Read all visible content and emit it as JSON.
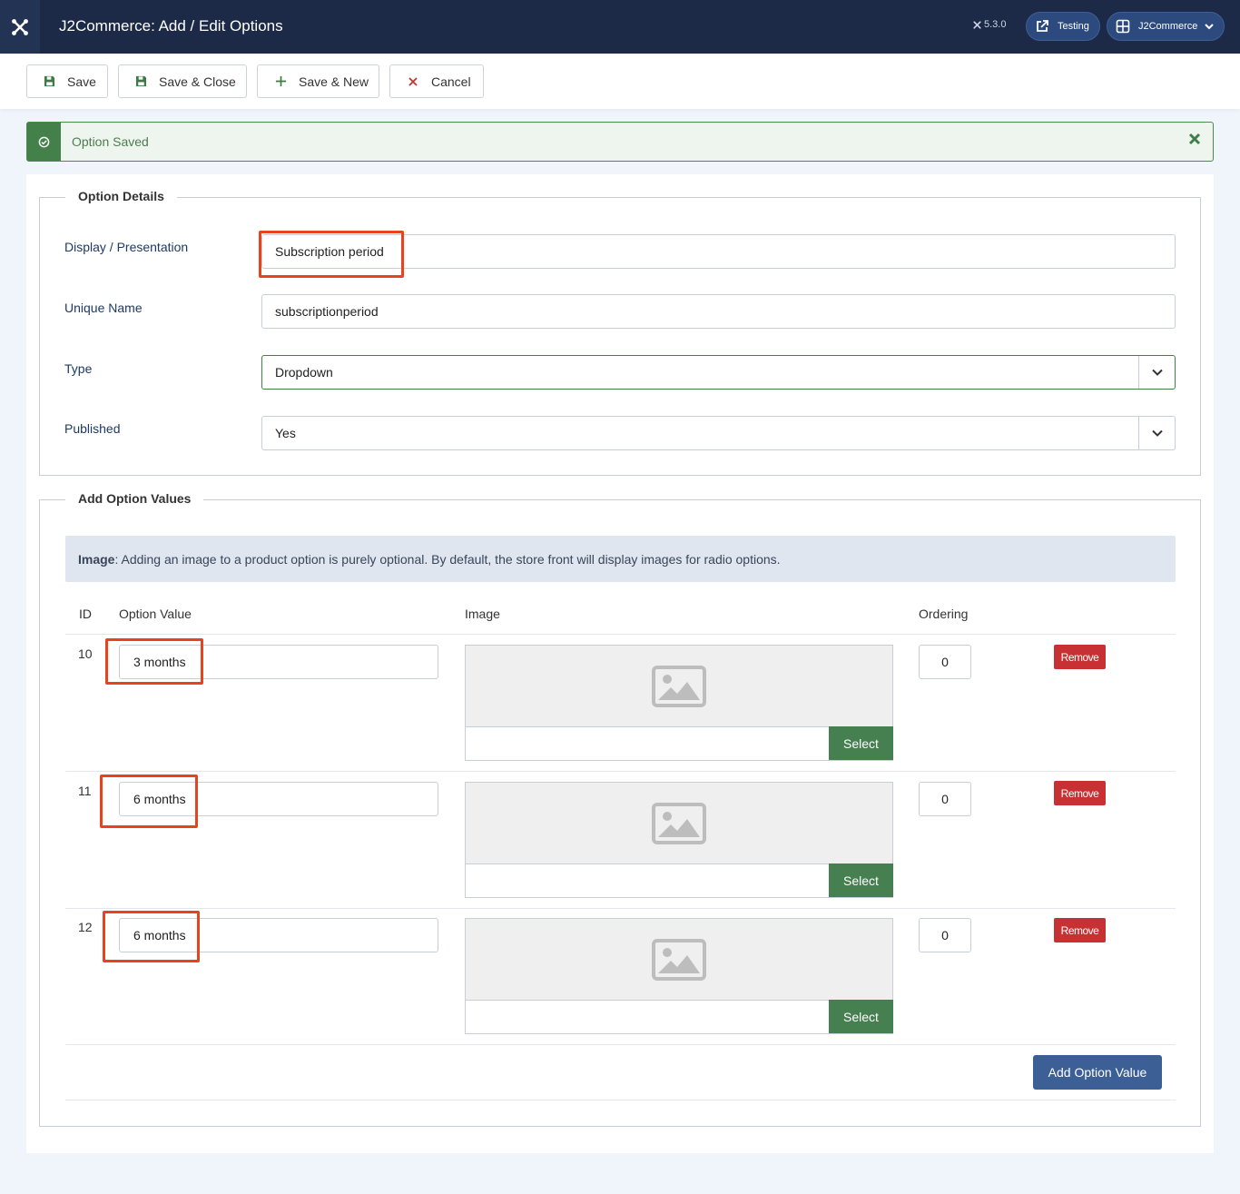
{
  "header": {
    "title": "J2Commerce: Add / Edit Options",
    "version": "5.3.0",
    "site_link_label": "Testing",
    "account_label": "J2Commerce"
  },
  "toolbar": {
    "save_label": "Save",
    "save_close_label": "Save & Close",
    "save_new_label": "Save & New",
    "cancel_label": "Cancel"
  },
  "alert": {
    "message": "Option Saved"
  },
  "option_details": {
    "legend": "Option Details",
    "display_label": "Display / Presentation",
    "display_value": "Subscription period",
    "unique_name_label": "Unique Name",
    "unique_name_value": "subscriptionperiod",
    "type_label": "Type",
    "type_value": "Dropdown",
    "published_label": "Published",
    "published_value": "Yes"
  },
  "option_values": {
    "legend": "Add Option Values",
    "info_bold": "Image",
    "info_text": ": Adding an image to a product option is purely optional. By default, the store front will display images for radio options.",
    "columns": {
      "id": "ID",
      "value": "Option Value",
      "image": "Image",
      "ordering": "Ordering"
    },
    "rows": [
      {
        "id": "10",
        "value": "3 months",
        "ordering": "0",
        "select_label": "Select",
        "remove_label": "Remove"
      },
      {
        "id": "11",
        "value": "6 months",
        "ordering": "0",
        "select_label": "Select",
        "remove_label": "Remove"
      },
      {
        "id": "12",
        "value": "6 months",
        "ordering": "0",
        "select_label": "Select",
        "remove_label": "Remove"
      }
    ],
    "add_label": "Add Option Value"
  },
  "colors": {
    "header_bg": "#1c2a47",
    "success": "#43804a",
    "danger": "#c73134",
    "primary": "#3c5f95",
    "highlight": "#e8431c"
  }
}
